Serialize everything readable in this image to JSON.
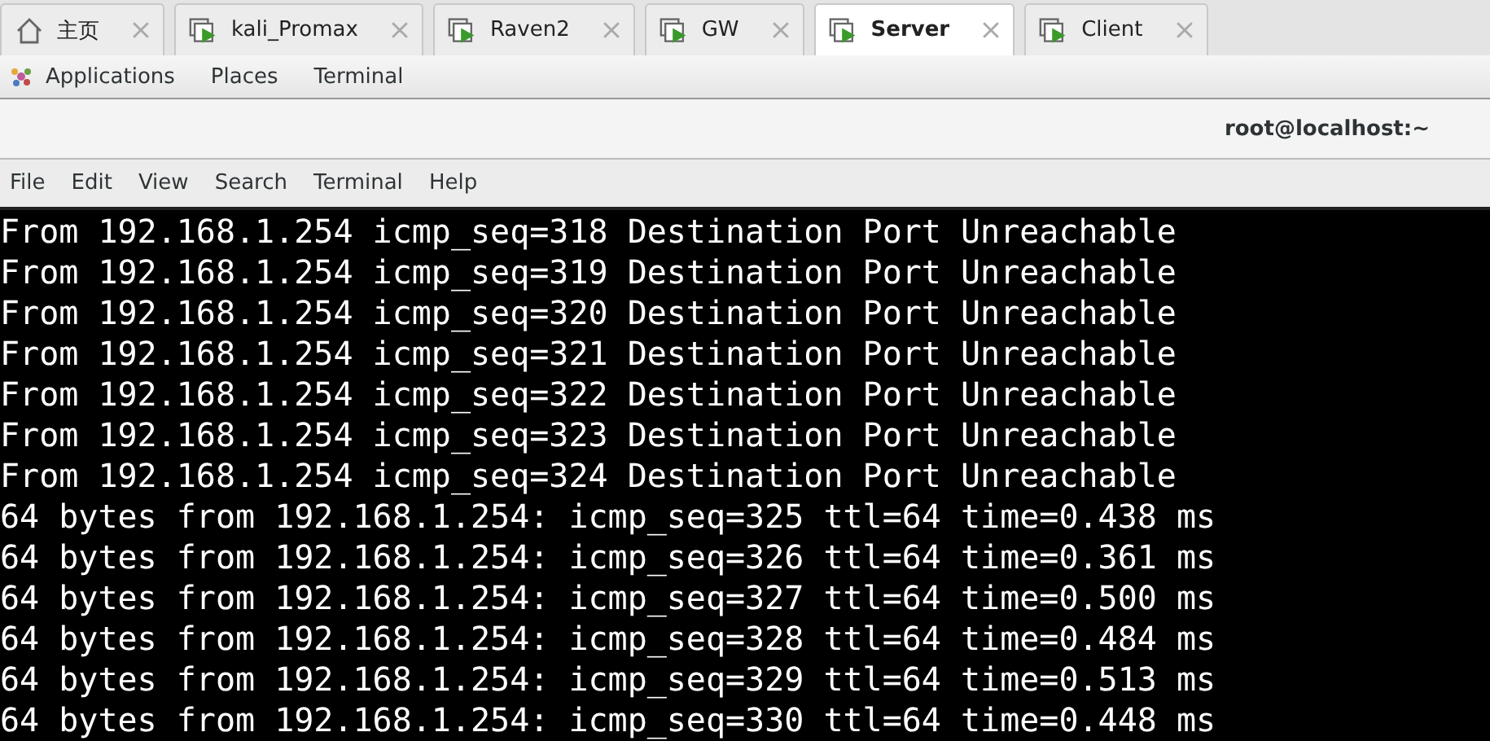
{
  "tabs": [
    {
      "label": "主页",
      "kind": "home",
      "selected": false
    },
    {
      "label": "kali_Promax",
      "kind": "vm",
      "selected": false
    },
    {
      "label": "Raven2",
      "kind": "vm",
      "selected": false
    },
    {
      "label": "GW",
      "kind": "vm",
      "selected": false
    },
    {
      "label": "Server",
      "kind": "vm",
      "selected": true
    },
    {
      "label": "Client",
      "kind": "vm",
      "selected": false
    }
  ],
  "top_bar": {
    "items": [
      "Applications",
      "Places",
      "Terminal"
    ]
  },
  "window": {
    "title": "root@localhost:~"
  },
  "menu": [
    "File",
    "Edit",
    "View",
    "Search",
    "Terminal",
    "Help"
  ],
  "terminal": {
    "lines": [
      "From 192.168.1.254 icmp_seq=318 Destination Port Unreachable",
      "From 192.168.1.254 icmp_seq=319 Destination Port Unreachable",
      "From 192.168.1.254 icmp_seq=320 Destination Port Unreachable",
      "From 192.168.1.254 icmp_seq=321 Destination Port Unreachable",
      "From 192.168.1.254 icmp_seq=322 Destination Port Unreachable",
      "From 192.168.1.254 icmp_seq=323 Destination Port Unreachable",
      "From 192.168.1.254 icmp_seq=324 Destination Port Unreachable",
      "64 bytes from 192.168.1.254: icmp_seq=325 ttl=64 time=0.438 ms",
      "64 bytes from 192.168.1.254: icmp_seq=326 ttl=64 time=0.361 ms",
      "64 bytes from 192.168.1.254: icmp_seq=327 ttl=64 time=0.500 ms",
      "64 bytes from 192.168.1.254: icmp_seq=328 ttl=64 time=0.484 ms",
      "64 bytes from 192.168.1.254: icmp_seq=329 ttl=64 time=0.513 ms",
      "64 bytes from 192.168.1.254: icmp_seq=330 ttl=64 time=0.448 ms"
    ]
  }
}
